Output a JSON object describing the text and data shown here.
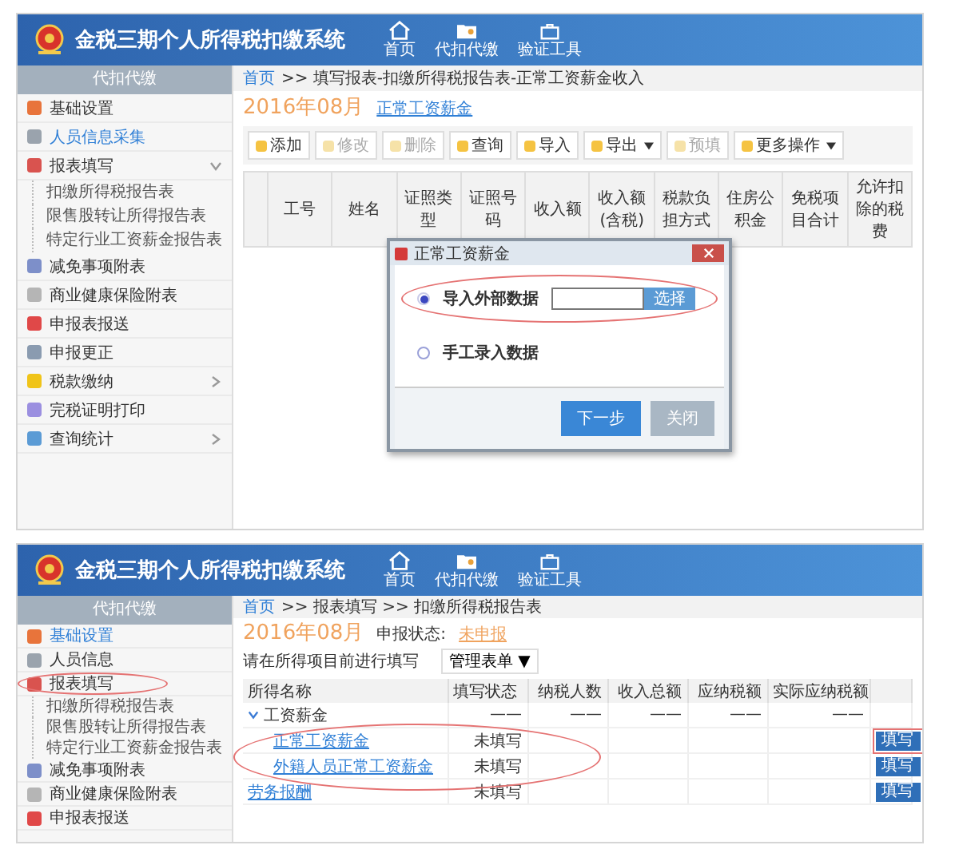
{
  "screens": [
    {
      "kind": "entry",
      "header": {
        "title": "金税三期个人所得税扣缴系统",
        "nav": [
          {
            "label": "首页"
          },
          {
            "label": "代扣代缴"
          },
          {
            "label": "验证工具"
          }
        ]
      },
      "sidebar": {
        "title": "代扣代缴",
        "items": [
          {
            "label": "基础设置",
            "color": "#e8743b",
            "selected": false,
            "expandable": false,
            "circled": false
          },
          {
            "label": "人员信息采集",
            "color": "#9aa3ad",
            "selected": true,
            "expandable": false,
            "circled": false
          },
          {
            "label": "报表填写",
            "color": "#d9534f",
            "selected": false,
            "expandable": true,
            "expanded": true,
            "circled": false,
            "children": [
              {
                "label": "扣缴所得税报告表"
              },
              {
                "label": "限售股转让所得报告表"
              },
              {
                "label": "特定行业工资薪金报告表"
              }
            ]
          },
          {
            "label": "减免事项附表",
            "color": "#7d8fc9",
            "selected": false,
            "expandable": false,
            "circled": false
          },
          {
            "label": "商业健康保险附表",
            "color": "#b5b5b5",
            "selected": false,
            "expandable": false,
            "circled": false
          },
          {
            "label": "申报表报送",
            "color": "#e04848",
            "selected": false,
            "expandable": false,
            "circled": false
          },
          {
            "label": "申报更正",
            "color": "#8a9bb0",
            "selected": false,
            "expandable": false,
            "circled": false
          },
          {
            "label": "税款缴纳",
            "color": "#f0c419",
            "selected": false,
            "expandable": true,
            "expanded": false,
            "circled": false
          },
          {
            "label": "完税证明打印",
            "color": "#9b8fe0",
            "selected": false,
            "expandable": false,
            "circled": false
          },
          {
            "label": "查询统计",
            "color": "#5b9bd5",
            "selected": false,
            "expandable": true,
            "expanded": false,
            "circled": false
          }
        ]
      },
      "breadcrumb": {
        "home": "首页",
        "path": ">> 填写报表-扣缴所得税报告表-正常工资薪金收入"
      },
      "period": "2016年08月",
      "subtitle": "正常工资薪金",
      "toolbar": [
        {
          "label": "添加",
          "disabled": false,
          "dropdown": false
        },
        {
          "label": "修改",
          "disabled": true,
          "dropdown": false
        },
        {
          "label": "删除",
          "disabled": true,
          "dropdown": false
        },
        {
          "label": "查询",
          "disabled": false,
          "dropdown": false
        },
        {
          "label": "导入",
          "disabled": false,
          "dropdown": false
        },
        {
          "label": "导出",
          "disabled": false,
          "dropdown": true
        },
        {
          "label": "预填",
          "disabled": true,
          "dropdown": false
        },
        {
          "label": "更多操作",
          "disabled": false,
          "dropdown": true
        }
      ],
      "columns": [
        "工号",
        "姓名",
        "证照类型",
        "证照号码",
        "收入额",
        "收入额(含税)",
        "税款负担方式",
        "住房公积金",
        "免税项目合计",
        "允许扣除的税费"
      ],
      "dialog": {
        "title": "正常工资薪金",
        "options": [
          {
            "label": "导入外部数据",
            "kind": "file",
            "selected": true,
            "circled": true,
            "button": "选择"
          },
          {
            "label": "手工录入数据",
            "kind": "plain",
            "selected": false,
            "circled": false
          }
        ],
        "buttons": [
          {
            "label": "下一步",
            "disabled": false
          },
          {
            "label": "关闭",
            "disabled": true
          }
        ]
      }
    },
    {
      "kind": "overview",
      "header": {
        "title": "金税三期个人所得税扣缴系统",
        "nav": [
          {
            "label": "首页"
          },
          {
            "label": "代扣代缴"
          },
          {
            "label": "验证工具"
          }
        ]
      },
      "sidebar": {
        "title": "代扣代缴",
        "items": [
          {
            "label": "基础设置",
            "color": "#e8743b",
            "selected": true,
            "expandable": false,
            "circled": false
          },
          {
            "label": "人员信息",
            "color": "#9aa3ad",
            "selected": false,
            "expandable": false,
            "circled": false
          },
          {
            "label": "报表填写",
            "color": "#d9534f",
            "selected": false,
            "expandable": false,
            "expanded": true,
            "circled": true,
            "children": [
              {
                "label": "扣缴所得税报告表"
              },
              {
                "label": "限售股转让所得报告表"
              },
              {
                "label": "特定行业工资薪金报告表"
              }
            ]
          },
          {
            "label": "减免事项附表",
            "color": "#7d8fc9",
            "selected": false,
            "expandable": false,
            "circled": false
          },
          {
            "label": "商业健康保险附表",
            "color": "#b5b5b5",
            "selected": false,
            "expandable": false,
            "circled": false
          },
          {
            "label": "申报表报送",
            "color": "#e04848",
            "selected": false,
            "expandable": false,
            "circled": false
          }
        ]
      },
      "breadcrumb": {
        "home": "首页",
        "path": ">> 报表填写 >> 扣缴所得税报告表"
      },
      "period": "2016年08月",
      "status_label": "申报状态:",
      "status": "未申报",
      "hint": "请在所得项目前进行填写",
      "menu_button": "管理表单 ▼",
      "columns": [
        "所得名称",
        "填写状态",
        "纳税人数",
        "收入总额",
        "应纳税额",
        "实际应纳税额"
      ],
      "rows": [
        {
          "cells": [
            "工资薪金",
            "——",
            "——",
            "——",
            "——",
            "——"
          ],
          "expanded": true,
          "circled": true,
          "children": [
            {
              "cells": [
                "正常工资薪金",
                "未填写"
              ],
              "action": "填写",
              "circled": true
            },
            {
              "cells": [
                "外籍人员正常工资薪金",
                "未填写"
              ],
              "action": "填写",
              "circled": false
            }
          ]
        },
        {
          "cells": [
            "劳务报酬",
            "未填写"
          ],
          "action": "填写",
          "circled": false
        }
      ]
    }
  ]
}
